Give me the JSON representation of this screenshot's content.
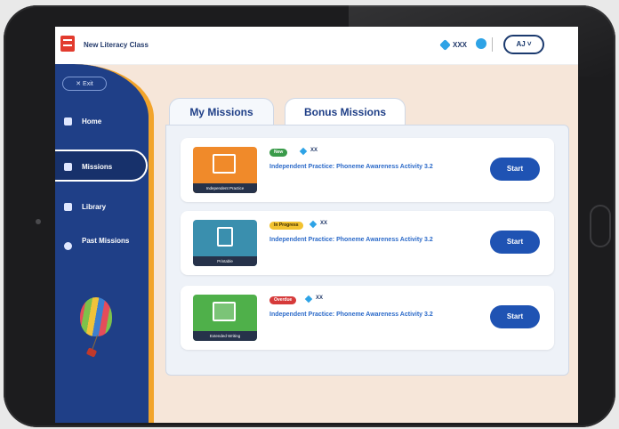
{
  "header": {
    "app_title": "New Literacy Class",
    "gem_count": "XXX",
    "user_initials": "AJ ˅"
  },
  "sidebar": {
    "exit_label": "✕ Exit",
    "items": [
      {
        "label": "Home",
        "icon": "home-icon"
      },
      {
        "label": "Missions",
        "icon": "missions-icon",
        "active": true
      },
      {
        "label": "Library",
        "icon": "library-icon"
      },
      {
        "label": "Past Missions",
        "icon": "past-missions-icon"
      }
    ]
  },
  "tabs": [
    {
      "label": "My Missions"
    },
    {
      "label": "Bonus Missions",
      "active": true
    }
  ],
  "missions": [
    {
      "thumb_caption": "Independent Practice",
      "thumb_color": "#f08a2a",
      "status": "New",
      "status_color": "#3a9b4a",
      "gems": "XX",
      "title": "Independent Practice: Phoneme Awareness Activity 3.2",
      "start_label": "Start"
    },
    {
      "thumb_caption": "Printable",
      "thumb_color": "#3a8fae",
      "status": "In Progress",
      "status_color": "#f2c230",
      "gems": "XX",
      "title": "Independent Practice: Phoneme Awareness Activity 3.2",
      "start_label": "Start"
    },
    {
      "thumb_caption": "Extended Writing",
      "thumb_color": "#4fb04a",
      "status": "Overdue",
      "status_color": "#d63a3a",
      "gems": "XX",
      "title": "Independent Practice: Phoneme Awareness Activity 3.2",
      "start_label": "Start"
    }
  ]
}
